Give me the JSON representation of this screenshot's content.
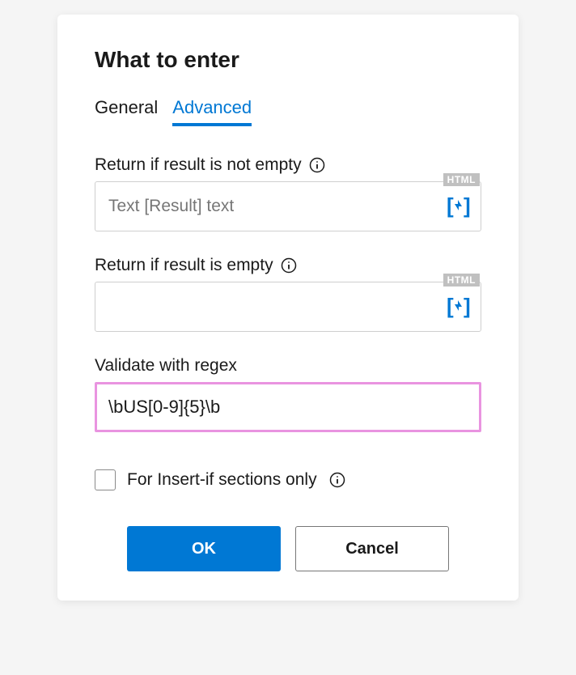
{
  "dialog": {
    "title": "What to enter"
  },
  "tabs": {
    "general": "General",
    "advanced": "Advanced"
  },
  "fields": {
    "notEmpty": {
      "label": "Return if result is not empty",
      "placeholder": "Text [Result] text",
      "value": "",
      "badge": "HTML"
    },
    "empty": {
      "label": "Return if result is empty",
      "placeholder": "",
      "value": "",
      "badge": "HTML"
    },
    "regex": {
      "label": "Validate with regex",
      "value": "\\bUS[0-9]{5}\\b"
    }
  },
  "checkbox": {
    "label": "For Insert-if sections only",
    "checked": false
  },
  "buttons": {
    "ok": "OK",
    "cancel": "Cancel"
  }
}
